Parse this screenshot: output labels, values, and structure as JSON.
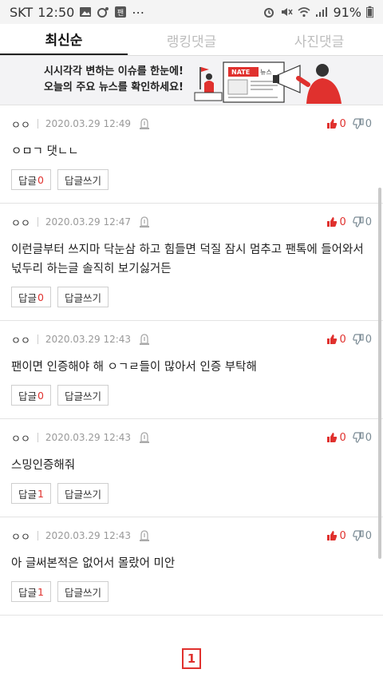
{
  "status_bar": {
    "carrier": "SKT",
    "time": "12:50",
    "extra": "⋯",
    "battery": "91%",
    "icons": [
      "image-icon",
      "notification-icon",
      "app-icon",
      "alarm-icon",
      "mute-icon",
      "wifi-icon",
      "signal-icon",
      "battery-icon"
    ]
  },
  "tabs": [
    {
      "label": "최신순",
      "active": true
    },
    {
      "label": "랭킹댓글",
      "active": false
    },
    {
      "label": "사진댓글",
      "active": false
    }
  ],
  "banner": {
    "line1": "시시각각 변하는 이슈를 한눈에!",
    "line2": "오늘의 주요 뉴스를 확인하세요!",
    "logo_text": "NATE 뉴스",
    "accent_color": "#e0312e"
  },
  "comments": [
    {
      "author": "ㅇㅇ",
      "date": "2020.03.29 12:49",
      "up": "0",
      "down": "0",
      "text": "ㅇㅁㄱ 댓ㄴㄴ",
      "reply_label": "답글",
      "reply_count": "0",
      "write_label": "답글쓰기"
    },
    {
      "author": "ㅇㅇ",
      "date": "2020.03.29 12:47",
      "up": "0",
      "down": "0",
      "text": "이런글부터 쓰지마 닥눈삼 하고 힘들면 덕질 잠시 멈추고 팬톡에 들어와서 넋두리 하는글 솔직히 보기싫거든",
      "reply_label": "답글",
      "reply_count": "0",
      "write_label": "답글쓰기"
    },
    {
      "author": "ㅇㅇ",
      "date": "2020.03.29 12:43",
      "up": "0",
      "down": "0",
      "text": "팬이면 인증해야 해 ㅇㄱㄹ들이 많아서 인증 부탁해",
      "reply_label": "답글",
      "reply_count": "0",
      "write_label": "답글쓰기"
    },
    {
      "author": "ㅇㅇ",
      "date": "2020.03.29 12:43",
      "up": "0",
      "down": "0",
      "text": "스밍인증해줘",
      "reply_label": "답글",
      "reply_count": "1",
      "write_label": "답글쓰기"
    },
    {
      "author": "ㅇㅇ",
      "date": "2020.03.29 12:43",
      "up": "0",
      "down": "0",
      "text": "아 글써본적은 없어서 몰랐어 미안",
      "reply_label": "답글",
      "reply_count": "1",
      "write_label": "답글쓰기"
    }
  ],
  "pagination": {
    "current": "1"
  }
}
